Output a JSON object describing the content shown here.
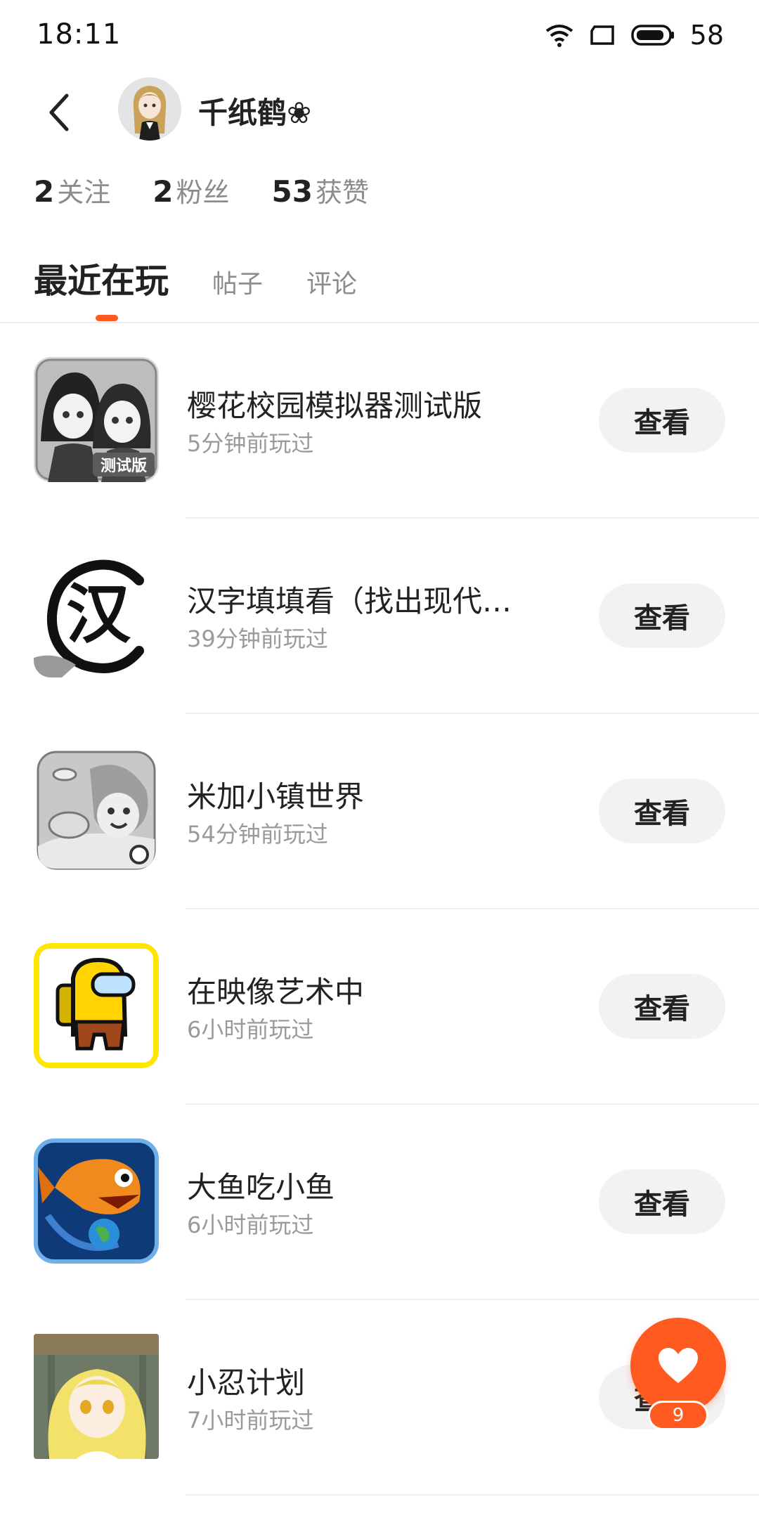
{
  "status_bar": {
    "time": "18:11",
    "battery": "58",
    "icons": [
      "wifi-icon",
      "screen-icon",
      "battery-icon"
    ]
  },
  "profile": {
    "back_icon": "back-arrow-icon",
    "username": "千纸鹤❀"
  },
  "stats": [
    {
      "count": "2",
      "label": "关注"
    },
    {
      "count": "2",
      "label": "粉丝"
    },
    {
      "count": "53",
      "label": "获赞"
    }
  ],
  "tabs": [
    {
      "label": "最近在玩",
      "active": true
    },
    {
      "label": "帖子",
      "active": false
    },
    {
      "label": "评论",
      "active": false
    }
  ],
  "games": [
    {
      "name": "樱花校园模拟器测试版",
      "played": "5分钟前玩过",
      "icon": "sakura-school-icon",
      "icon_badge": "测试版",
      "button": "查看"
    },
    {
      "name": "汉字填填看（找出现代…",
      "played": "39分钟前玩过",
      "icon": "hanzi-icon",
      "icon_text": "汉",
      "button": "查看"
    },
    {
      "name": "米加小镇世界",
      "played": "54分钟前玩过",
      "icon": "miga-town-icon",
      "button": "查看"
    },
    {
      "name": "在映像艺术中",
      "played": "6小时前玩过",
      "icon": "among-us-icon",
      "button": "查看"
    },
    {
      "name": "大鱼吃小鱼",
      "played": "6小时前玩过",
      "icon": "big-fish-icon",
      "button": "查看"
    },
    {
      "name": "小忍计划",
      "played": "7小时前玩过",
      "icon": "shinobu-icon",
      "button": "查看"
    }
  ],
  "fab": {
    "icon": "heart-icon",
    "badge": "9"
  },
  "colors": {
    "accent": "#ff5a1f",
    "button_bg": "#f2f2f2",
    "muted_text": "#9a9a9a"
  }
}
